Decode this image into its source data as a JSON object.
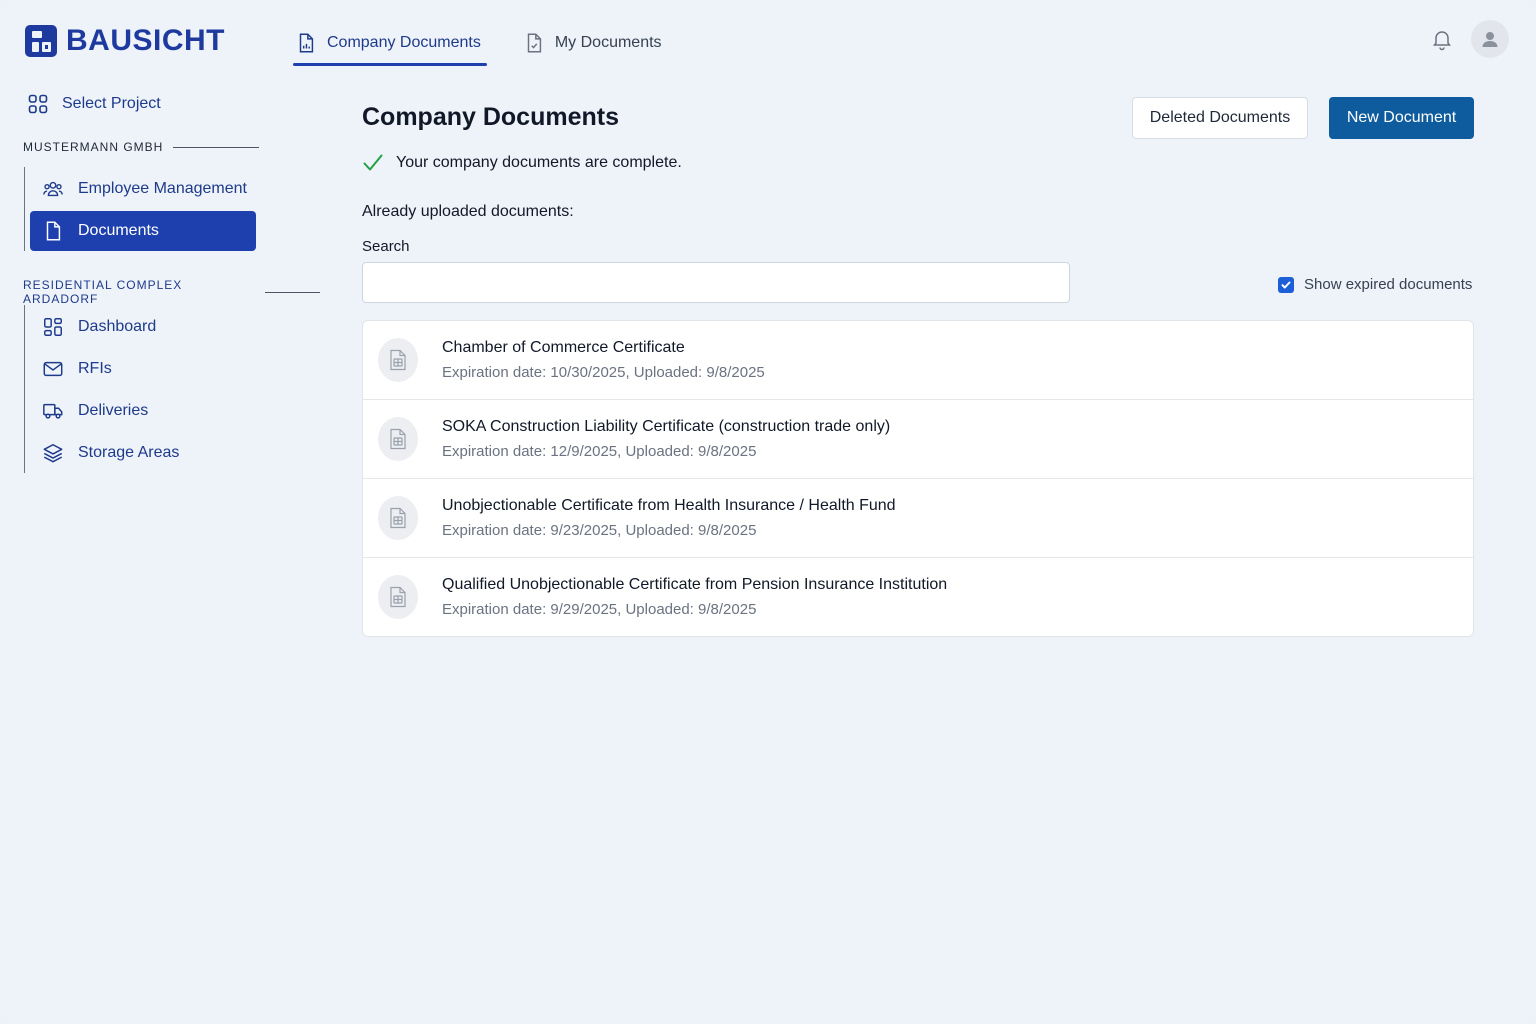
{
  "app": {
    "brand": "BAUSICHT",
    "accent_color": "#1e40af",
    "primary_button_color": "#0e5c9e"
  },
  "header": {
    "tabs": [
      {
        "label": "Company Documents",
        "icon": "document-chart-icon",
        "active": true
      },
      {
        "label": "My Documents",
        "icon": "document-check-icon",
        "active": false
      }
    ]
  },
  "sidebar": {
    "select_project": "Select Project",
    "company_section": "MUSTERMANN GMBH",
    "company_items": [
      {
        "label": "Employee Management",
        "icon": "users-icon",
        "active": false
      },
      {
        "label": "Documents",
        "icon": "document-icon",
        "active": true
      }
    ],
    "project_section": "RESIDENTIAL COMPLEX ARDADORF",
    "project_items": [
      {
        "label": "Dashboard",
        "icon": "dashboard-icon"
      },
      {
        "label": "RFIs",
        "icon": "mail-icon"
      },
      {
        "label": "Deliveries",
        "icon": "truck-icon"
      },
      {
        "label": "Storage Areas",
        "icon": "layers-icon"
      }
    ]
  },
  "main": {
    "title": "Company Documents",
    "deleted_button": "Deleted Documents",
    "new_button": "New Document",
    "status_text": "Your company documents are complete.",
    "uploaded_label": "Already uploaded documents:",
    "search_label": "Search",
    "search_value": "",
    "show_expired_label": "Show expired documents",
    "show_expired_checked": true,
    "documents": [
      {
        "name": "Chamber of Commerce Certificate",
        "meta": "Expiration date: 10/30/2025, Uploaded: 9/8/2025"
      },
      {
        "name": "SOKA Construction Liability Certificate (construction trade only)",
        "meta": "Expiration date: 12/9/2025, Uploaded: 9/8/2025"
      },
      {
        "name": "Unobjectionable Certificate from Health Insurance / Health Fund",
        "meta": "Expiration date: 9/23/2025, Uploaded: 9/8/2025"
      },
      {
        "name": "Qualified Unobjectionable Certificate from Pension Insurance Institution",
        "meta": "Expiration date: 9/29/2025, Uploaded: 9/8/2025"
      }
    ]
  }
}
